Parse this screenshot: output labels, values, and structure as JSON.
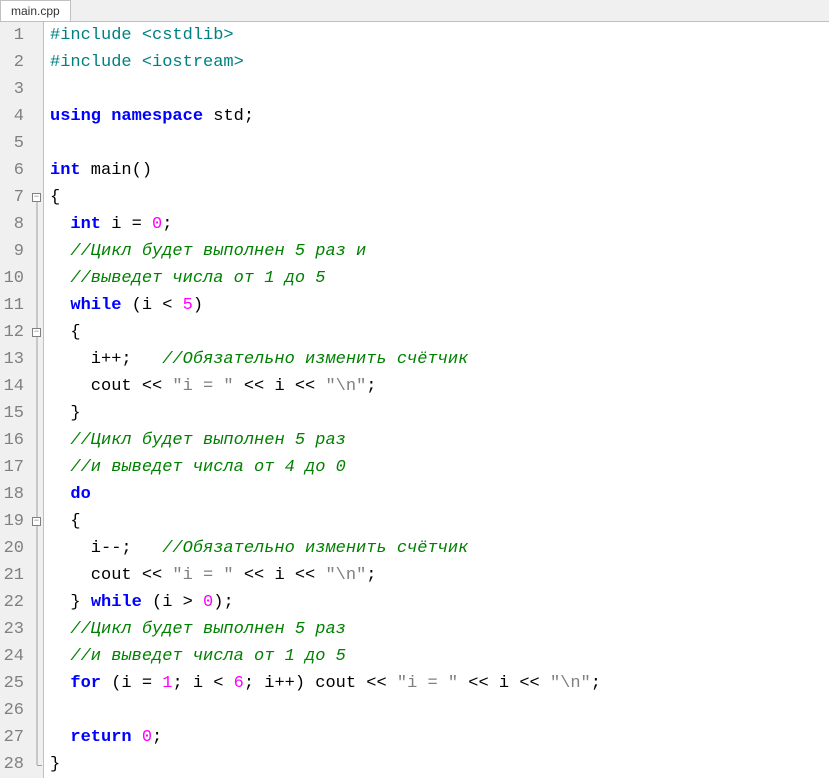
{
  "tab": {
    "title": "main.cpp"
  },
  "lines": [
    {
      "num": 1,
      "fold": "",
      "tokens": [
        [
          "preproc",
          "#include <cstdlib>"
        ]
      ]
    },
    {
      "num": 2,
      "fold": "",
      "tokens": [
        [
          "preproc",
          "#include <iostream>"
        ]
      ]
    },
    {
      "num": 3,
      "fold": "",
      "tokens": []
    },
    {
      "num": 4,
      "fold": "",
      "tokens": [
        [
          "keyword",
          "using"
        ],
        [
          "default",
          " "
        ],
        [
          "keyword",
          "namespace"
        ],
        [
          "default",
          " std;"
        ]
      ]
    },
    {
      "num": 5,
      "fold": "",
      "tokens": []
    },
    {
      "num": 6,
      "fold": "",
      "tokens": [
        [
          "keyword",
          "int"
        ],
        [
          "default",
          " main()"
        ]
      ]
    },
    {
      "num": 7,
      "fold": "open",
      "tokens": [
        [
          "default",
          "{"
        ]
      ]
    },
    {
      "num": 8,
      "fold": "mid",
      "tokens": [
        [
          "default",
          "  "
        ],
        [
          "keyword",
          "int"
        ],
        [
          "default",
          " i = "
        ],
        [
          "number",
          "0"
        ],
        [
          "default",
          ";"
        ]
      ]
    },
    {
      "num": 9,
      "fold": "mid",
      "tokens": [
        [
          "default",
          "  "
        ],
        [
          "comment",
          "//Цикл будет выполнен 5 раз и"
        ]
      ]
    },
    {
      "num": 10,
      "fold": "mid",
      "tokens": [
        [
          "default",
          "  "
        ],
        [
          "comment",
          "//выведет числа от 1 до 5"
        ]
      ]
    },
    {
      "num": 11,
      "fold": "mid",
      "tokens": [
        [
          "default",
          "  "
        ],
        [
          "keyword",
          "while"
        ],
        [
          "default",
          " (i < "
        ],
        [
          "number",
          "5"
        ],
        [
          "default",
          ")"
        ]
      ]
    },
    {
      "num": 12,
      "fold": "open-mid",
      "tokens": [
        [
          "default",
          "  {"
        ]
      ]
    },
    {
      "num": 13,
      "fold": "mid",
      "tokens": [
        [
          "default",
          "    i++;   "
        ],
        [
          "comment",
          "//Обязательно изменить счётчик"
        ]
      ]
    },
    {
      "num": 14,
      "fold": "mid",
      "tokens": [
        [
          "default",
          "    cout << "
        ],
        [
          "string",
          "\"i = \""
        ],
        [
          "default",
          " << i << "
        ],
        [
          "string",
          "\"\\n\""
        ],
        [
          "default",
          ";"
        ]
      ]
    },
    {
      "num": 15,
      "fold": "mid",
      "tokens": [
        [
          "default",
          "  }"
        ]
      ]
    },
    {
      "num": 16,
      "fold": "mid",
      "tokens": [
        [
          "default",
          "  "
        ],
        [
          "comment",
          "//Цикл будет выполнен 5 раз"
        ]
      ]
    },
    {
      "num": 17,
      "fold": "mid",
      "tokens": [
        [
          "default",
          "  "
        ],
        [
          "comment",
          "//и выведет числа от 4 до 0"
        ]
      ]
    },
    {
      "num": 18,
      "fold": "mid",
      "tokens": [
        [
          "default",
          "  "
        ],
        [
          "keyword",
          "do"
        ]
      ]
    },
    {
      "num": 19,
      "fold": "open-mid",
      "tokens": [
        [
          "default",
          "  {"
        ]
      ]
    },
    {
      "num": 20,
      "fold": "mid",
      "tokens": [
        [
          "default",
          "    i--;   "
        ],
        [
          "comment",
          "//Обязательно изменить счётчик"
        ]
      ]
    },
    {
      "num": 21,
      "fold": "mid",
      "tokens": [
        [
          "default",
          "    cout << "
        ],
        [
          "string",
          "\"i = \""
        ],
        [
          "default",
          " << i << "
        ],
        [
          "string",
          "\"\\n\""
        ],
        [
          "default",
          ";"
        ]
      ]
    },
    {
      "num": 22,
      "fold": "mid",
      "tokens": [
        [
          "default",
          "  } "
        ],
        [
          "keyword",
          "while"
        ],
        [
          "default",
          " (i > "
        ],
        [
          "number",
          "0"
        ],
        [
          "default",
          ");"
        ]
      ]
    },
    {
      "num": 23,
      "fold": "mid",
      "tokens": [
        [
          "default",
          "  "
        ],
        [
          "comment",
          "//Цикл будет выполнен 5 раз"
        ]
      ]
    },
    {
      "num": 24,
      "fold": "mid",
      "tokens": [
        [
          "default",
          "  "
        ],
        [
          "comment",
          "//и выведет числа от 1 до 5"
        ]
      ]
    },
    {
      "num": 25,
      "fold": "mid",
      "tokens": [
        [
          "default",
          "  "
        ],
        [
          "keyword",
          "for"
        ],
        [
          "default",
          " (i = "
        ],
        [
          "number",
          "1"
        ],
        [
          "default",
          "; i < "
        ],
        [
          "number",
          "6"
        ],
        [
          "default",
          "; i++) cout << "
        ],
        [
          "string",
          "\"i = \""
        ],
        [
          "default",
          " << i << "
        ],
        [
          "string",
          "\"\\n\""
        ],
        [
          "default",
          ";"
        ]
      ]
    },
    {
      "num": 26,
      "fold": "mid",
      "tokens": []
    },
    {
      "num": 27,
      "fold": "mid",
      "tokens": [
        [
          "default",
          "  "
        ],
        [
          "keyword",
          "return"
        ],
        [
          "default",
          " "
        ],
        [
          "number",
          "0"
        ],
        [
          "default",
          ";"
        ]
      ]
    },
    {
      "num": 28,
      "fold": "end",
      "tokens": [
        [
          "default",
          "}"
        ]
      ]
    }
  ]
}
